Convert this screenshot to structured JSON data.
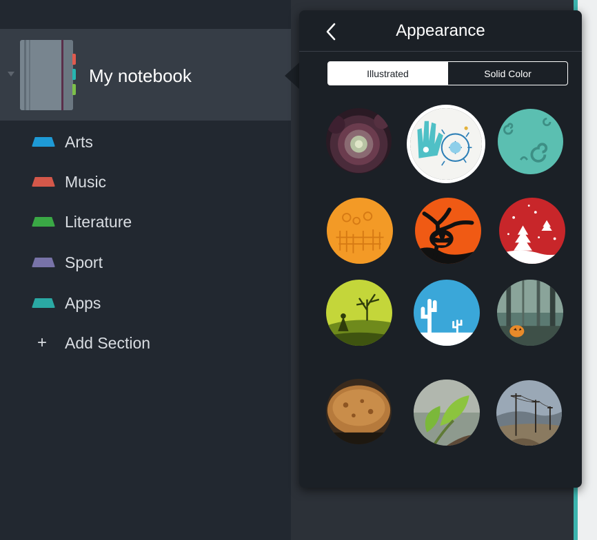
{
  "notebook": {
    "title": "My notebook",
    "tab_colors": [
      "#e05a4e",
      "#26b5b0",
      "#7cc04a"
    ]
  },
  "sections": [
    {
      "label": "Arts",
      "color": "#1e9ad6"
    },
    {
      "label": "Music",
      "color": "#d4584a"
    },
    {
      "label": "Literature",
      "color": "#3aa845"
    },
    {
      "label": "Sport",
      "color": "#7873a8"
    },
    {
      "label": "Apps",
      "color": "#2aa9a4"
    }
  ],
  "add_section": {
    "icon": "+",
    "label": "Add Section"
  },
  "appearance": {
    "title": "Appearance",
    "back_icon": "chevron-left-icon",
    "tabs": [
      {
        "label": "Illustrated",
        "active": true
      },
      {
        "label": "Solid Color",
        "active": false
      }
    ],
    "backgrounds": [
      {
        "name": "succulent",
        "selected": false
      },
      {
        "name": "hand-sketch",
        "selected": true
      },
      {
        "name": "teal-spirals",
        "selected": false
      },
      {
        "name": "orange-figures",
        "selected": false
      },
      {
        "name": "halloween-tree",
        "selected": false
      },
      {
        "name": "christmas-trees",
        "selected": false
      },
      {
        "name": "witch-hill",
        "selected": false
      },
      {
        "name": "desert-cactus",
        "selected": false
      },
      {
        "name": "forest-pumpkin",
        "selected": false
      },
      {
        "name": "cookie",
        "selected": false
      },
      {
        "name": "leaf-sprout",
        "selected": false
      },
      {
        "name": "power-lines",
        "selected": false
      }
    ]
  },
  "colors": {
    "sidebar_bg": "#222830",
    "selected_row": "#363d46",
    "popover_bg": "#1b2026",
    "accent_strip": "#3cb4ae"
  }
}
